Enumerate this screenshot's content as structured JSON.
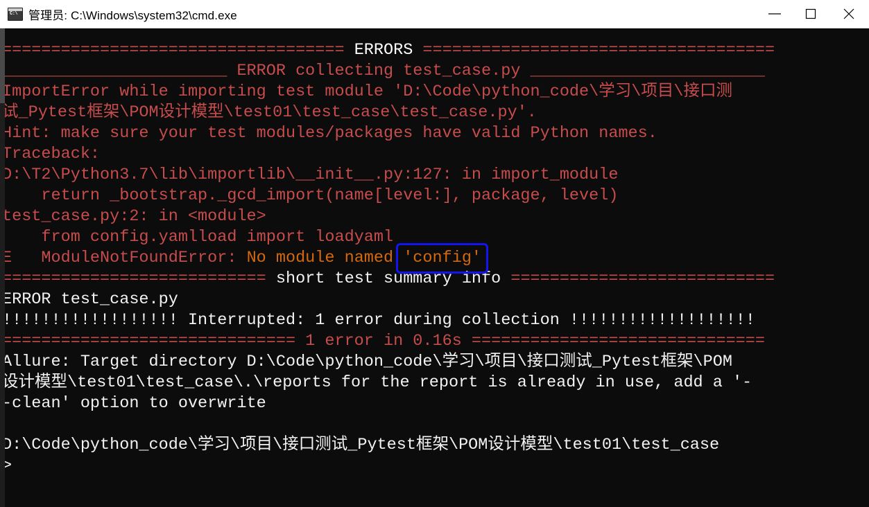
{
  "window": {
    "title": "管理员: C:\\Windows\\system32\\cmd.exe",
    "icon_glyph": "C:\\",
    "controls": {
      "minimize_label": "Minimize",
      "maximize_label": "Maximize",
      "close_label": "Close"
    }
  },
  "console": {
    "background_color": "#0c0c0c",
    "error_color": "#c74c4c",
    "bright_color": "#f2f2f2",
    "highlight_color": "#d4690f",
    "annotation_color": "#1414f0",
    "lines": [
      {
        "id": "errors-banner",
        "segments": [
          {
            "text": "=================================== ",
            "style": "red"
          },
          {
            "text": "ERRORS",
            "style": "bwhite"
          },
          {
            "text": " ====================================",
            "style": "red"
          }
        ]
      },
      {
        "id": "error-collecting",
        "segments": [
          {
            "text": "_______________________ ERROR collecting test_case.py ________________________",
            "style": "red"
          }
        ]
      },
      {
        "id": "import-error-1",
        "segments": [
          {
            "text": "ImportError while importing test module 'D:\\Code\\python_code\\学习\\项目\\接口测",
            "style": "red"
          }
        ]
      },
      {
        "id": "import-error-2",
        "segments": [
          {
            "text": "试_Pytest框架\\POM设计模型\\test01\\test_case\\test_case.py'.",
            "style": "red"
          }
        ]
      },
      {
        "id": "hint",
        "segments": [
          {
            "text": "Hint: make sure your test modules/packages have valid Python names.",
            "style": "red"
          }
        ]
      },
      {
        "id": "traceback-label",
        "segments": [
          {
            "text": "Traceback:",
            "style": "red"
          }
        ]
      },
      {
        "id": "traceback-frame-1",
        "segments": [
          {
            "text": "D:\\T2\\Python3.7\\lib\\importlib\\__init__.py:127: in import_module",
            "style": "red"
          }
        ]
      },
      {
        "id": "traceback-code-1",
        "segments": [
          {
            "text": "    return _bootstrap._gcd_import(name[level:], package, level)",
            "style": "red"
          }
        ]
      },
      {
        "id": "traceback-frame-2",
        "segments": [
          {
            "text": "test_case.py:2: in <module>",
            "style": "red"
          }
        ]
      },
      {
        "id": "traceback-code-2",
        "segments": [
          {
            "text": "    from config.yamlload import loadyaml",
            "style": "red"
          }
        ]
      },
      {
        "id": "module-not-found",
        "segments": [
          {
            "text": "E   ModuleNotFoundError: ",
            "style": "red"
          },
          {
            "text": "No module named ",
            "style": "orange"
          },
          {
            "text": "'config'",
            "style": "orange"
          }
        ]
      },
      {
        "id": "summary-banner",
        "segments": [
          {
            "text": "=========================== ",
            "style": "red"
          },
          {
            "text": "short test summary info",
            "style": "white"
          },
          {
            "text": " ===========================",
            "style": "red"
          }
        ]
      },
      {
        "id": "summary-error",
        "segments": [
          {
            "text": "ERROR test_case.py",
            "style": "white"
          }
        ]
      },
      {
        "id": "interrupted",
        "segments": [
          {
            "text": "!!!!!!!!!!!!!!!!!! Interrupted: 1 error during collection !!!!!!!!!!!!!!!!!!!",
            "style": "white"
          }
        ]
      },
      {
        "id": "error-time",
        "segments": [
          {
            "text": "============================== 1 error in 0.16s ==============================",
            "style": "red"
          }
        ]
      },
      {
        "id": "allure-1",
        "segments": [
          {
            "text": "Allure: Target directory D:\\Code\\python_code\\学习\\项目\\接口测试_Pytest框架\\POM",
            "style": "white"
          }
        ]
      },
      {
        "id": "allure-2",
        "segments": [
          {
            "text": "设计模型\\test01\\test_case\\.\\reports for the report is already in use, add a '-",
            "style": "white"
          }
        ]
      },
      {
        "id": "allure-3",
        "segments": [
          {
            "text": "-clean' option to overwrite",
            "style": "white"
          }
        ]
      },
      {
        "id": "spacer",
        "segments": [
          {
            "text": " ",
            "style": "blank"
          }
        ]
      },
      {
        "id": "prompt-path",
        "segments": [
          {
            "text": "D:\\Code\\python_code\\学习\\项目\\接口测试_Pytest框架\\POM设计模型\\test01\\test_case",
            "style": "white"
          }
        ]
      },
      {
        "id": "prompt-caret",
        "segments": [
          {
            "text": ">",
            "style": "white"
          }
        ]
      }
    ]
  },
  "annotation": {
    "label": "config-highlight-box",
    "color": "#1414f0"
  }
}
